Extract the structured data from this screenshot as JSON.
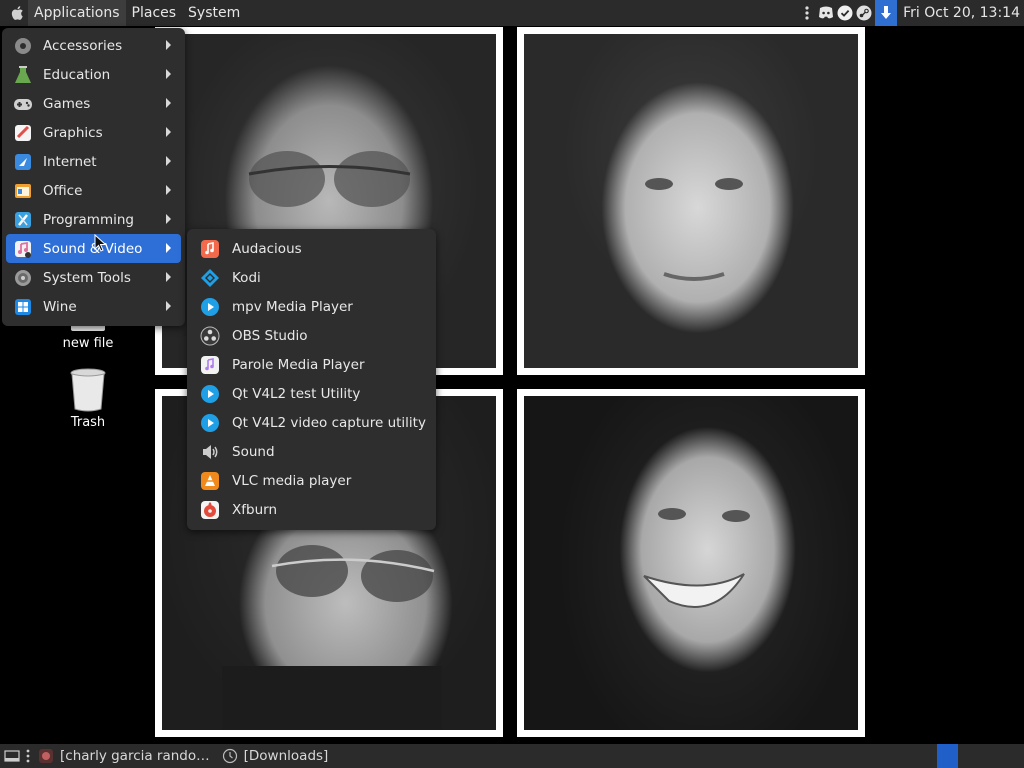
{
  "top_panel": {
    "menus": [
      "Applications",
      "Places",
      "System"
    ],
    "clock": "Fri Oct 20, 13:14",
    "tray_icons": [
      "dots-icon",
      "discord-icon",
      "check-circle-icon",
      "steam-icon",
      "download-icon"
    ]
  },
  "desktop_icons": [
    {
      "label": "new file",
      "icon": "file-icon"
    },
    {
      "label": "Trash",
      "icon": "trash-icon"
    }
  ],
  "app_menu": {
    "items": [
      {
        "label": "Accessories",
        "icon": "accessories-icon",
        "color": "#8a8a8a"
      },
      {
        "label": "Education",
        "icon": "education-icon",
        "color": "#6aa84f"
      },
      {
        "label": "Games",
        "icon": "games-icon",
        "color": "#cfcfcf"
      },
      {
        "label": "Graphics",
        "icon": "graphics-icon",
        "color": "#e0504a"
      },
      {
        "label": "Internet",
        "icon": "internet-icon",
        "color": "#3a8be0"
      },
      {
        "label": "Office",
        "icon": "office-icon",
        "color": "#f0a030"
      },
      {
        "label": "Programming",
        "icon": "programming-icon",
        "color": "#3aa0e0"
      },
      {
        "label": "Sound & Video",
        "icon": "sound-video-icon",
        "color": "#e070a0"
      },
      {
        "label": "System Tools",
        "icon": "system-tools-icon",
        "color": "#9a9a9a"
      },
      {
        "label": "Wine",
        "icon": "wine-icon",
        "color": "#1e88e5"
      }
    ],
    "selected_index": 7,
    "selected_color": "#2d6fd7"
  },
  "sub_menu": {
    "items": [
      {
        "label": "Audacious",
        "icon": "audacious-icon",
        "color": "#f26a4b"
      },
      {
        "label": "Kodi",
        "icon": "kodi-icon",
        "color": "#1f9fe6"
      },
      {
        "label": "mpv Media Player",
        "icon": "mpv-icon",
        "color": "#1f9fe6"
      },
      {
        "label": "OBS Studio",
        "icon": "obs-icon",
        "color": "#3a3a3a"
      },
      {
        "label": "Parole Media Player",
        "icon": "parole-icon",
        "color": "#b07cf0"
      },
      {
        "label": "Qt V4L2 test Utility",
        "icon": "qt-v4l2-icon",
        "color": "#1f9fe6"
      },
      {
        "label": "Qt V4L2 video capture utility",
        "icon": "qt-v4l2-capture-icon",
        "color": "#1f9fe6"
      },
      {
        "label": "Sound",
        "icon": "speaker-icon",
        "color": "#cccccc"
      },
      {
        "label": "VLC media player",
        "icon": "vlc-icon",
        "color": "#f08a1c"
      },
      {
        "label": "Xfburn",
        "icon": "xfburn-icon",
        "color": "#e24b3b"
      }
    ]
  },
  "bottom_panel": {
    "tasks": [
      {
        "label": "[charly garcia rando…",
        "icon": "browser-icon"
      },
      {
        "label": "[Downloads]",
        "icon": "download-clock-icon"
      }
    ],
    "workspace_color": "#1f5fc7"
  }
}
